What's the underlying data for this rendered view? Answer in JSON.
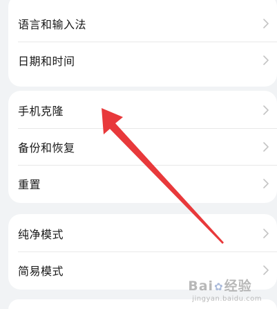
{
  "groups": [
    {
      "items": [
        {
          "label": "语言和输入法"
        },
        {
          "label": "日期和时间"
        }
      ]
    },
    {
      "items": [
        {
          "label": "手机克隆"
        },
        {
          "label": "备份和恢复"
        },
        {
          "label": "重置"
        }
      ]
    },
    {
      "items": [
        {
          "label": "纯净模式"
        },
        {
          "label": "简易模式"
        }
      ]
    }
  ],
  "annotation": {
    "color": "#e8393b",
    "points_to": "手机克隆"
  },
  "watermark": {
    "brand_left": "Bai",
    "brand_right": "经验",
    "url": "jingyan.baidu.com"
  }
}
